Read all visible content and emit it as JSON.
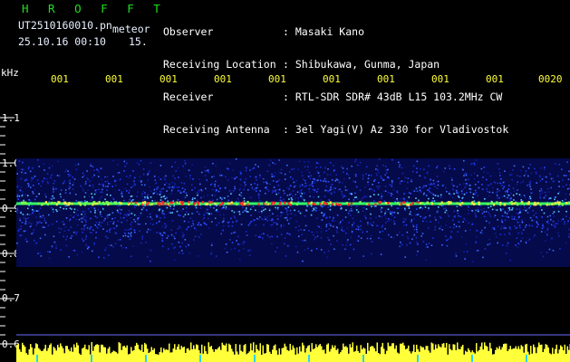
{
  "header": {
    "brand": "H R O F F T",
    "file_name": "UT2510160010.pn",
    "meteor_label": "meteor",
    "datetime": "25.10.16 00:10",
    "minute": "15.",
    "info": [
      {
        "label": "Observer",
        "value": ": Masaki Kano"
      },
      {
        "label": "Receiving Location",
        "value": ": Shibukawa, Gunma, Japan"
      },
      {
        "label": "Receiver",
        "value": ": RTL-SDR SDR# 43dB L15 103.2MHz CW"
      },
      {
        "label": "Receiving Antenna",
        "value": ": 3el Yagi(V) Az 330 for Vladivostok"
      }
    ]
  },
  "axis": {
    "unit": "kHz",
    "ticks": [
      "1.1",
      "1.0",
      "0.9",
      "0.8",
      "0.7",
      "0.6"
    ],
    "time_labels": [
      "001",
      "001",
      "001",
      "001",
      "001",
      "001",
      "001",
      "001",
      "001",
      "0020"
    ]
  },
  "colors": {
    "background": "#000000",
    "header_green": "#1ee01e",
    "time_yellow": "#ffff3a",
    "noise_blue": "#1630d8",
    "signal_red": "#ff2a2a",
    "signal_green": "#33ff66",
    "grid_line": "#6d6dff"
  },
  "spectrogram": {
    "band_top_khz": 1.01,
    "band_bottom_khz": 0.77,
    "carrier_khz": 0.91
  }
}
